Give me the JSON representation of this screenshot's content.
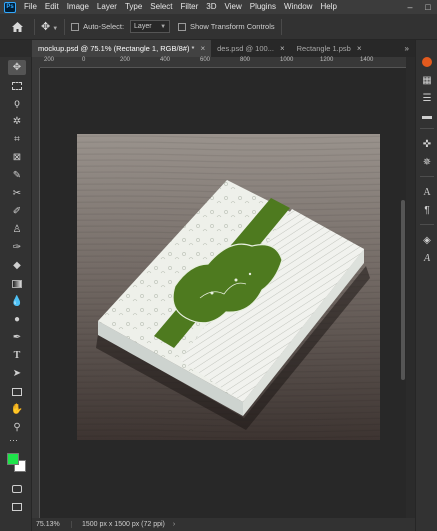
{
  "app": {
    "logo": "Ps"
  },
  "menu": [
    "File",
    "Edit",
    "Image",
    "Layer",
    "Type",
    "Select",
    "Filter",
    "3D",
    "View",
    "Plugins",
    "Window",
    "Help"
  ],
  "window_controls": {
    "minimize": "–",
    "maximize": "□"
  },
  "options_bar": {
    "auto_select_label": "Auto-Select:",
    "auto_select_value": "Layer",
    "show_transform_label": "Show Transform Controls"
  },
  "tabs": [
    {
      "label": "mockup.psd @ 75.1% (Rectangle 1, RGB/8#) *",
      "close": "×"
    },
    {
      "label": "des.psd @ 100...",
      "close": "×"
    },
    {
      "label": "Rectangle 1.psb",
      "close": "×"
    }
  ],
  "tab_more": "»",
  "ruler_top_labels": [
    "200",
    "0",
    "200",
    "400",
    "600",
    "800",
    "1000",
    "1200",
    "1400"
  ],
  "status": {
    "zoom": "75.13%",
    "doc_info": "1500 px x 1500 px (72 ppi)",
    "arrow": "›"
  },
  "colors": {
    "foreground": "#1ee34a",
    "background": "#ffffff",
    "ribbon_green": "#4e7a1f",
    "box_white": "#eef1ee"
  },
  "tool_icons": [
    "move-tool-icon",
    "artboard-icon",
    "lasso-icon",
    "magic-wand-icon",
    "crop-icon",
    "frame-icon",
    "eyedropper-icon",
    "healing-brush-icon",
    "brush-icon",
    "stamp-icon",
    "history-brush-icon",
    "eraser-icon",
    "gradient-icon",
    "blur-icon",
    "dodge-icon",
    "pen-icon",
    "type-icon",
    "path-select-icon",
    "rectangle-icon",
    "hand-icon",
    "zoom-icon",
    "more-tools-icon",
    "quick-mask-icon",
    "screen-mode-icon"
  ],
  "panel_icons": [
    "color-icon",
    "swatches-icon",
    "properties-icon",
    "adjustments-icon",
    "comments-icon",
    "libraries-icon",
    "navigator-icon",
    "character-icon",
    "paragraph-icon",
    "layers-icon",
    "glyphs-icon"
  ]
}
